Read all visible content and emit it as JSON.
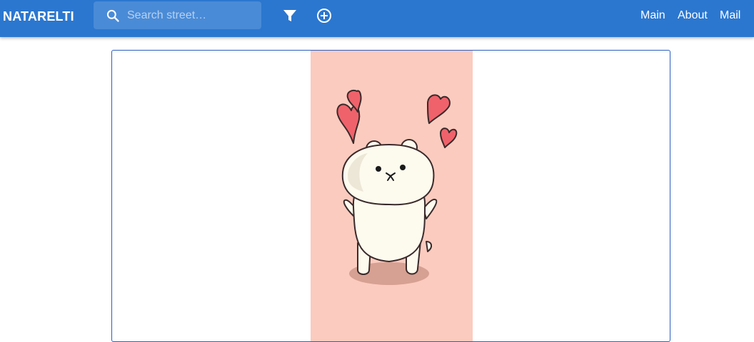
{
  "header": {
    "brand": "NATARELTI",
    "search": {
      "placeholder": "Search street…",
      "value": ""
    },
    "icons": {
      "search": "search-icon",
      "filter": "filter-icon",
      "add": "add-circle-icon"
    },
    "nav": [
      {
        "label": "Main"
      },
      {
        "label": "About"
      },
      {
        "label": "Mail"
      }
    ]
  },
  "content": {
    "image": {
      "description_icon": "bear-with-hearts-illustration"
    }
  },
  "colors": {
    "appbar": "#2b77d0",
    "card_border": "#2b5fc0",
    "image_background": "#fbcbbf",
    "heart": "#f0626b",
    "bear": "#fdfaee"
  }
}
